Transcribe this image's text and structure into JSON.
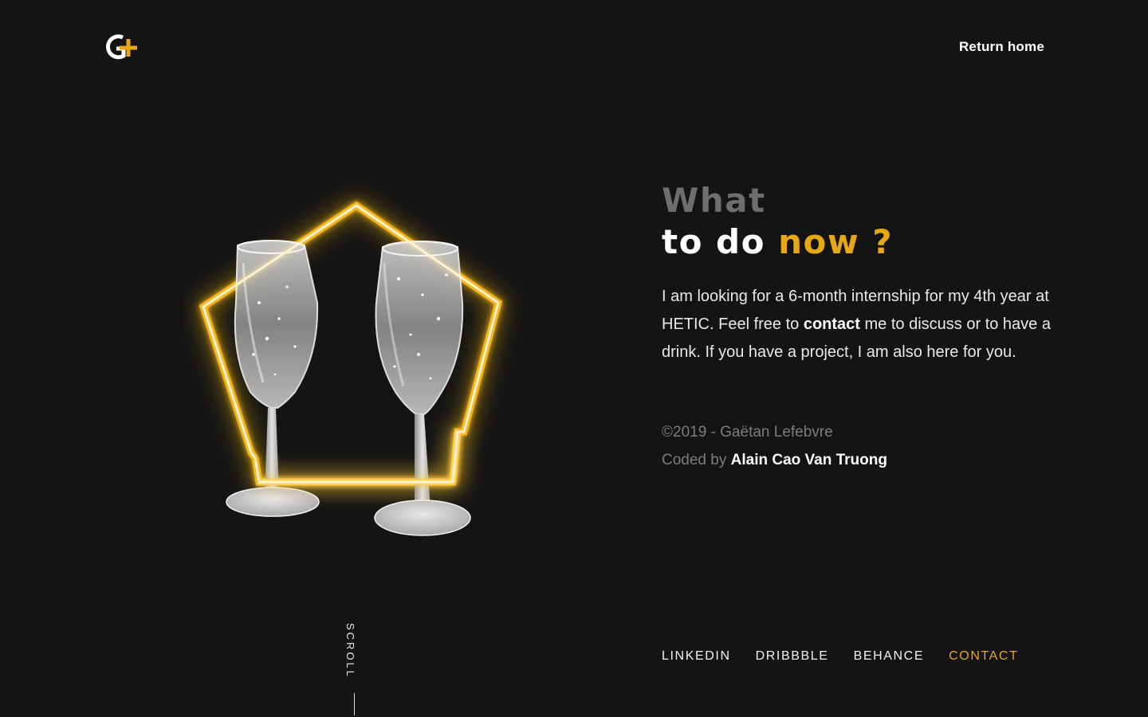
{
  "header": {
    "logo_icon": "g-plus-logo",
    "return_home_label": "Return home"
  },
  "hero": {
    "heading_line1": "What",
    "heading_line2_prefix": "to do ",
    "heading_line2_accent": "now ?",
    "intro_part1": "I am looking for a 6-month internship for my 4th year at HETIC. Feel free to ",
    "intro_link": "contact",
    "intro_part2": " me to discuss or to have a drink. If you have a project, I am also here for you.",
    "copyright": "©2019 - Gaëtan Lefebvre",
    "coded_by_prefix": "Coded by ",
    "coded_by_name": "Alain Cao Van Truong"
  },
  "social": {
    "linkedin": "LINKEDIN",
    "dribbble": "DRIBBBLE",
    "behance": "BEHANCE",
    "contact": "CONTACT"
  },
  "scroll": {
    "label": "SCROLL"
  },
  "colors": {
    "background": "#141414",
    "accent": "#e6a817",
    "muted": "#6e6e6e"
  }
}
